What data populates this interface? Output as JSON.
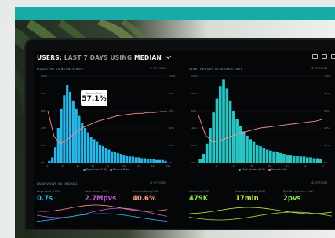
{
  "dashboard": {
    "title_prefix": "USERS:",
    "title_range": "LAST 7 DAYS",
    "title_using": "USING",
    "title_metric": "MEDIAN"
  },
  "panels": {
    "load_bounce": {
      "title": "LOAD TIME VS BOUNCE RATE",
      "options": "⚙ OPTIONS",
      "legend_a": "Page Load (LUX)",
      "legend_b": "Bounce Rate",
      "tooltip_label": "Bounce Rate",
      "tooltip_value": "57.1%"
    },
    "start_render": {
      "title": "START RENDER VS BOUNCE RATE",
      "options": "⚙ OPTIONS",
      "legend_a": "Start Render (LUX)",
      "legend_b": "Bounce Rate"
    },
    "page_views": {
      "title": "PAGE VIEWS VS ONLOAD",
      "options": "⚙ OPTIONS"
    },
    "sessions": {
      "options": "⚙ OPTIONS"
    }
  },
  "stats": [
    {
      "label": "Page Load (LUX)",
      "value": "0.7s",
      "color": "#29b6e8"
    },
    {
      "label": "Page Views (LUX)",
      "value": "2.7Mpvs",
      "color": "#c85ad8"
    },
    {
      "label": "Bounce Rate (LUX)",
      "value": "40.6%",
      "color": "#ff9a88"
    },
    {
      "label": "Sessions (LUX)",
      "value": "479K",
      "color": "#8ce04a"
    },
    {
      "label": "Session Length (LUX)",
      "value": "17min",
      "color": "#c8e84a"
    },
    {
      "label": "PVs Per Session (LUX)",
      "value": "2pvs",
      "color": "#8ce04a"
    }
  ],
  "chart_data": [
    {
      "type": "bar",
      "title": "LOAD TIME VS BOUNCE RATE",
      "x_ticks": [
        "0",
        "2s",
        "4s",
        "6s",
        "8s",
        "10s",
        "12s",
        "14s",
        "16s"
      ],
      "y_ticks": [
        "100%",
        "80%",
        "60%",
        "40%",
        "20%",
        "0%"
      ],
      "series": [
        {
          "name": "Page Load (LUX)",
          "values": [
            2,
            6,
            18,
            40,
            62,
            78,
            90,
            82,
            72,
            62,
            54,
            46,
            40,
            35,
            30,
            27,
            24,
            21,
            19,
            17,
            15,
            13,
            12,
            11,
            10,
            9,
            8,
            7,
            7,
            6,
            6,
            5,
            5,
            4,
            4,
            4,
            3,
            3,
            3,
            2
          ]
        },
        {
          "name": "Bounce Rate",
          "values": [
            60,
            30,
            22,
            26,
            32,
            38,
            42,
            45,
            48,
            50,
            52,
            54,
            55,
            56,
            57,
            57,
            58,
            58,
            59,
            59
          ]
        }
      ]
    },
    {
      "type": "bar",
      "title": "START RENDER VS BOUNCE RATE",
      "x_ticks": [
        "0",
        "1s",
        "2s",
        "3s",
        "4s",
        "5s",
        "6s",
        "7s"
      ],
      "y_ticks": [
        "100%",
        "80%",
        "60%",
        "40%",
        "20%",
        "0%"
      ],
      "series": [
        {
          "name": "Start Render (LUX)",
          "values": [
            4,
            10,
            22,
            40,
            58,
            74,
            88,
            96,
            86,
            72,
            60,
            50,
            42,
            36,
            31,
            27,
            24,
            21,
            19,
            17,
            15,
            14,
            13,
            12,
            11,
            10,
            9,
            9,
            8,
            8,
            7,
            7,
            6,
            6,
            5,
            5,
            4
          ]
        },
        {
          "name": "Bounce Rate",
          "values": [
            55,
            32,
            24,
            25,
            28,
            31,
            34,
            36,
            38,
            40,
            41,
            42,
            43,
            44,
            45,
            46,
            47,
            48,
            50
          ]
        }
      ]
    }
  ]
}
